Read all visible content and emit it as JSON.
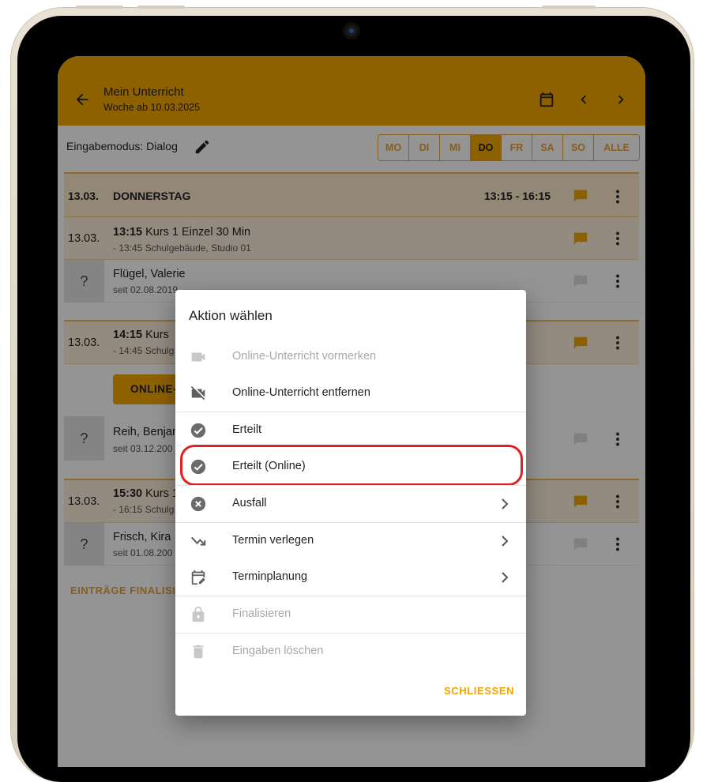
{
  "appbar": {
    "title": "Mein Unterricht",
    "subtitle": "Woche ab 10.03.2025"
  },
  "mode": {
    "label": "Eingabemodus: Dialog",
    "days": [
      "MO",
      "DI",
      "MI",
      "DO",
      "FR",
      "SA",
      "SO",
      "ALLE"
    ],
    "active_day": "DO"
  },
  "day_header": {
    "date": "13.03.",
    "weekday": "DONNERSTAG",
    "time": "13:15 - 16:15"
  },
  "lessons": [
    {
      "date": "13.03.",
      "time": "13:15",
      "course": " Kurs 1 Einzel 30 Min",
      "detail": "- 13:45 Schulgebäude, Studio 01",
      "student_name": "Flügel, Valerie",
      "student_since": "seit 02.08.2019"
    },
    {
      "date": "13.03.",
      "time": "14:15",
      "course": " Kurs",
      "detail": "- 14:45 Schulg",
      "button": "ONLINE-",
      "student_name": "Reih, Benjam",
      "student_since": "seit 03.12.200"
    },
    {
      "date": "13.03.",
      "time": "15:30",
      "course": " Kurs 1",
      "detail": "- 16:15 Schulg",
      "student_name": "Frisch, Kira",
      "student_since": "seit 01.08.200"
    }
  ],
  "unknown_avatar": "?",
  "finalize_link": "EINTRÄGE FINALISIER",
  "dialog": {
    "title": "Aktion wählen",
    "items": [
      {
        "label": "Online-Unterricht vormerken",
        "icon": "video-camera-icon",
        "disabled": true
      },
      {
        "label": "Online-Unterricht entfernen",
        "icon": "video-off-icon",
        "disabled": false
      },
      {
        "label": "Erteilt",
        "icon": "check-circle-icon",
        "disabled": false
      },
      {
        "label": "Erteilt (Online)",
        "icon": "check-circle-icon",
        "disabled": false
      },
      {
        "label": "Ausfall",
        "icon": "cancel-circle-icon",
        "disabled": false,
        "submenu": true
      },
      {
        "label": "Termin verlegen",
        "icon": "move-arrow-icon",
        "disabled": false,
        "submenu": true
      },
      {
        "label": "Terminplanung",
        "icon": "calendar-edit-icon",
        "disabled": false,
        "submenu": true
      },
      {
        "label": "Finalisieren",
        "icon": "lock-icon",
        "disabled": true
      },
      {
        "label": "Eingaben löschen",
        "icon": "trash-icon",
        "disabled": true
      }
    ],
    "close_label": "SCHLIESSEN"
  },
  "colors": {
    "accent": "#f4a700",
    "highlight": "#e31f1f"
  }
}
